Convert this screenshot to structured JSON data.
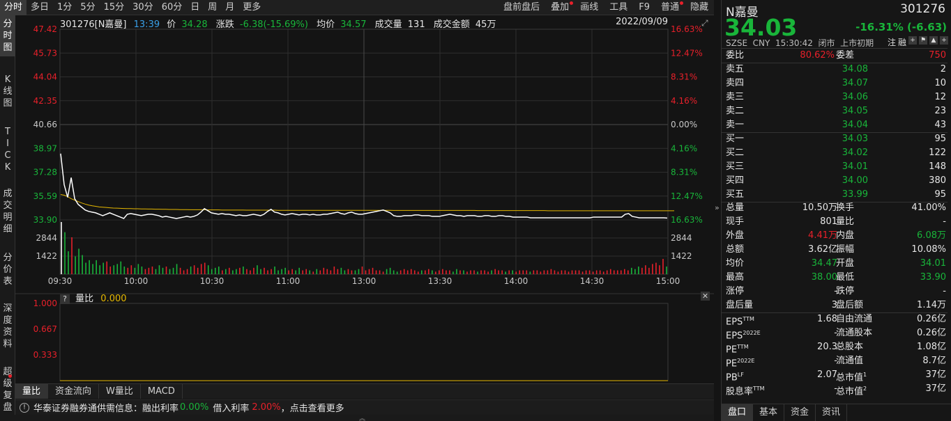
{
  "toolbar": {
    "items": [
      "分时",
      "多日",
      "1分",
      "5分",
      "15分",
      "30分",
      "60分",
      "日",
      "周",
      "月",
      "更多"
    ],
    "active_index": 0,
    "right_items": [
      "盘前盘后",
      "叠加",
      "画线",
      "工具",
      "F9",
      "普通",
      "隐藏"
    ]
  },
  "left_tabs": [
    "分时图",
    "K线图",
    "TICK",
    "成交明细",
    "分价表",
    "深度资料",
    "超级复盘"
  ],
  "chart_info": {
    "code": "301276[N嘉曼]",
    "time": "13:39",
    "price_label": "价",
    "price": "34.28",
    "change_label": "涨跌",
    "change": "-6.38(-15.69%)",
    "avg_label": "均价",
    "avg": "34.57",
    "vol_label": "成交量",
    "vol": "131",
    "amount_label": "成交金额",
    "amount": "45万",
    "date": "2022/09/09"
  },
  "chart_data": {
    "type": "line",
    "price_ticks": [
      "47.42",
      "45.73",
      "44.04",
      "42.35",
      "40.66",
      "38.97",
      "37.28",
      "35.59",
      "33.90"
    ],
    "pct_ticks": [
      "16.63%",
      "12.47%",
      "8.31%",
      "4.16%",
      "0.00%",
      "4.16%",
      "8.31%",
      "12.47%",
      "16.63%"
    ],
    "y_range": [
      33.9,
      47.42
    ],
    "prev_close": 40.66,
    "vol_ticks": [
      "2844",
      "1422"
    ],
    "vol_range": [
      0,
      4266
    ],
    "time_ticks": [
      "09:30",
      "10:00",
      "10:30",
      "11:00",
      "13:00",
      "13:30",
      "14:00",
      "14:30",
      "15:00"
    ],
    "price_series": [
      38.6,
      36.4,
      35.5,
      36.9,
      35.4,
      35.0,
      34.8,
      34.6,
      34.5,
      34.45,
      34.4,
      34.3,
      34.2,
      34.3,
      34.4,
      34.3,
      34.2,
      34.1,
      34.0,
      34.3,
      34.35,
      34.3,
      34.25,
      34.2,
      34.25,
      34.3,
      34.3,
      34.25,
      34.2,
      34.1,
      34.15,
      34.1,
      34.05,
      34.0,
      34.05,
      34.1,
      34.15,
      34.1,
      34.15,
      34.25,
      34.45,
      34.7,
      34.55,
      34.4,
      34.35,
      34.3,
      34.35,
      34.3,
      34.3,
      34.25,
      34.2,
      34.25,
      34.2,
      34.2,
      34.25,
      34.3,
      34.25,
      34.2,
      34.3,
      34.5,
      34.65,
      34.45,
      34.4,
      34.3,
      34.25,
      34.3,
      34.35,
      34.3,
      34.25,
      34.3,
      34.3,
      34.25,
      34.3,
      34.25,
      34.25,
      34.3,
      34.3,
      34.35,
      34.4,
      34.45,
      34.35,
      34.3,
      34.4,
      34.45,
      34.35,
      34.3,
      34.3,
      34.35,
      34.4,
      34.45,
      34.5,
      34.55,
      34.6,
      34.5,
      34.4,
      34.2,
      34.15,
      34.15,
      34.2,
      34.2,
      34.2,
      34.25,
      34.25,
      34.2,
      34.2,
      34.2,
      34.15,
      34.15,
      34.15,
      34.2,
      34.25,
      34.3,
      34.25,
      34.2,
      34.2,
      34.15,
      34.2,
      34.2,
      34.2,
      34.15,
      34.15,
      34.2,
      34.2,
      34.15,
      34.15,
      34.2,
      34.2,
      34.15,
      34.15,
      34.1,
      34.1,
      34.1,
      34.1,
      34.1,
      34.05,
      34.05,
      34.05,
      34.05,
      34.05,
      34.05,
      34.05,
      34.05,
      34.05,
      34.05,
      34.05,
      34.05,
      34.05,
      34.05,
      34.05,
      34.05,
      34.05,
      34.05,
      34.1,
      34.1,
      34.1,
      34.1,
      34.1,
      34.1,
      34.1,
      34.1,
      34.1,
      34.3,
      34.35,
      34.15,
      34.1,
      34.05,
      34.05,
      34.05,
      34.05,
      34.05,
      34.05,
      34.05,
      34.05,
      34.03
    ],
    "avg_series": [
      35.7,
      35.65,
      35.55,
      35.4,
      35.3,
      35.2,
      35.1,
      35.02,
      34.95,
      34.9,
      34.86,
      34.82,
      34.8,
      34.78,
      34.76,
      34.74,
      34.73,
      34.72,
      34.71,
      34.7,
      34.7,
      34.69,
      34.69,
      34.68,
      34.68,
      34.67,
      34.67,
      34.66,
      34.66,
      34.65,
      34.65,
      34.64,
      34.64,
      34.64,
      34.63,
      34.63,
      34.63,
      34.62,
      34.62,
      34.62,
      34.62,
      34.62,
      34.61,
      34.61,
      34.61,
      34.61,
      34.6,
      34.6,
      34.6,
      34.6,
      34.6,
      34.6,
      34.6,
      34.59,
      34.59,
      34.59,
      34.59,
      34.59,
      34.59,
      34.59,
      34.59,
      34.59,
      34.58,
      34.58,
      34.58,
      34.58,
      34.58,
      34.58,
      34.58,
      34.58,
      34.58,
      34.58,
      34.58,
      34.58,
      34.58,
      34.58,
      34.58,
      34.58,
      34.58,
      34.58,
      34.58,
      34.58,
      34.58,
      34.58,
      34.58,
      34.58,
      34.58,
      34.58,
      34.58,
      34.58,
      34.58,
      34.58,
      34.58,
      34.58,
      34.58,
      34.57,
      34.57,
      34.57,
      34.57,
      34.57,
      34.57,
      34.57,
      34.57,
      34.57,
      34.57,
      34.57,
      34.57,
      34.57,
      34.57,
      34.57,
      34.57,
      34.57,
      34.57,
      34.57,
      34.57,
      34.57,
      34.57,
      34.57,
      34.57,
      34.56,
      34.56,
      34.56,
      34.56,
      34.56,
      34.56,
      34.56,
      34.56,
      34.56,
      34.56,
      34.56,
      34.56,
      34.56,
      34.56,
      34.56,
      34.56,
      34.56,
      34.56,
      34.56,
      34.56,
      34.55,
      34.55,
      34.55,
      34.55,
      34.55,
      34.55,
      34.55,
      34.55,
      34.55,
      34.55,
      34.55,
      34.55,
      34.55,
      34.55,
      34.55,
      34.55,
      34.55,
      34.55,
      34.55,
      34.55,
      34.55,
      34.55,
      34.55,
      34.55,
      34.55,
      34.55,
      34.55,
      34.55,
      34.55,
      34.55,
      34.55,
      34.55,
      34.55,
      34.55,
      34.55,
      34.55,
      34.55
    ],
    "volume_series": [
      4100,
      3300,
      1800,
      2900,
      1400,
      2000,
      1500,
      900,
      1100,
      800,
      1100,
      700,
      900,
      1000,
      600,
      700,
      800,
      1000,
      600,
      500,
      700,
      500,
      800,
      600,
      400,
      500,
      600,
      400,
      700,
      500,
      600,
      400,
      500,
      800,
      500,
      300,
      400,
      600,
      700,
      500,
      800,
      900,
      700,
      400,
      500,
      600,
      300,
      400,
      500,
      300,
      400,
      500,
      600,
      400,
      300,
      500,
      700,
      400,
      500,
      300,
      400,
      600,
      300,
      400,
      500,
      300,
      400,
      300,
      500,
      300,
      400,
      300,
      200,
      400,
      300,
      500,
      400,
      300,
      600,
      400,
      500,
      300,
      400,
      300,
      300,
      400,
      600,
      300,
      400,
      500,
      300,
      300,
      200,
      400,
      500,
      300,
      200,
      300,
      400,
      300,
      400,
      300,
      200,
      300,
      300,
      400,
      300,
      200,
      300,
      400,
      300,
      300,
      200,
      400,
      300,
      300,
      200,
      300,
      300,
      200,
      300,
      300,
      200,
      300,
      400,
      300,
      300,
      200,
      300,
      300,
      200,
      300,
      300,
      300,
      200,
      300,
      300,
      200,
      300,
      300,
      400,
      300,
      200,
      300,
      300,
      200,
      300,
      300,
      300,
      200,
      300,
      300,
      200,
      300,
      300,
      200,
      300,
      400,
      300,
      300,
      300,
      400,
      300,
      500,
      400,
      600,
      500,
      700,
      500,
      800,
      900,
      700,
      1200,
      600
    ],
    "ratio_ticks": [
      "1.000",
      "0.667",
      "0.333"
    ]
  },
  "sub_chart": {
    "help": "?",
    "label": "量比",
    "value": "0.000"
  },
  "bottom_tabs": [
    "量比",
    "资金流向",
    "W量比",
    "MACD"
  ],
  "status": {
    "text1": "华泰证券融券通供需信息：融出利率",
    "rate1": "0.00%",
    "text2": "借入利率",
    "rate2": "2.00%",
    "text3": "，点击查看更多"
  },
  "right_panel": {
    "name": "N嘉曼",
    "code": "301276",
    "price": "34.03",
    "change": "-16.31% (-6.63)",
    "meta": "SZSE  CNY  15:30:42  闭市  上市初期",
    "meta_icons": [
      "注",
      "融",
      "+",
      "⚑",
      "▲",
      "+"
    ],
    "weibi": {
      "label": "委比",
      "value": "80.62%",
      "label2": "委差",
      "value2": "750"
    },
    "asks": [
      {
        "label": "卖五",
        "price": "34.08",
        "vol": "2"
      },
      {
        "label": "卖四",
        "price": "34.07",
        "vol": "10"
      },
      {
        "label": "卖三",
        "price": "34.06",
        "vol": "12"
      },
      {
        "label": "卖二",
        "price": "34.05",
        "vol": "23"
      },
      {
        "label": "卖一",
        "price": "34.04",
        "vol": "43"
      }
    ],
    "bids": [
      {
        "label": "买一",
        "price": "34.03",
        "vol": "95"
      },
      {
        "label": "买二",
        "price": "34.02",
        "vol": "122"
      },
      {
        "label": "买三",
        "price": "34.01",
        "vol": "148"
      },
      {
        "label": "买四",
        "price": "34.00",
        "vol": "380"
      },
      {
        "label": "买五",
        "price": "33.99",
        "vol": "95"
      }
    ],
    "stats": [
      {
        "l1": "总量",
        "v1": "10.50万",
        "c1": "white",
        "l2": "换手",
        "v2": "41.00%",
        "c2": "white"
      },
      {
        "l1": "现手",
        "v1": "801",
        "c1": "white",
        "l2": "量比",
        "v2": "-",
        "c2": "white"
      },
      {
        "l1": "外盘",
        "v1": "4.41万",
        "c1": "red",
        "l2": "内盘",
        "v2": "6.08万",
        "c2": "green"
      },
      {
        "l1": "总额",
        "v1": "3.62亿",
        "c1": "white",
        "l2": "振幅",
        "v2": "10.08%",
        "c2": "white"
      },
      {
        "l1": "均价",
        "v1": "34.47",
        "c1": "green",
        "l2": "开盘",
        "v2": "34.01",
        "c2": "green"
      },
      {
        "l1": "最高",
        "v1": "38.00",
        "c1": "green",
        "l2": "最低",
        "v2": "33.90",
        "c2": "green"
      },
      {
        "l1": "涨停",
        "v1": "-",
        "c1": "white",
        "l2": "跌停",
        "v2": "-",
        "c2": "white"
      },
      {
        "l1": "盘后量",
        "v1": "3",
        "c1": "white",
        "l2": "盘后额",
        "v2": "1.14万",
        "c2": "white"
      }
    ],
    "fund": [
      {
        "l1": "EPS",
        "s1": "TTM",
        "v1": "1.68",
        "l2": "自由流通",
        "s2": "",
        "v2": "0.26亿"
      },
      {
        "l1": "EPS",
        "s1": "2022E",
        "v1": "-",
        "l2": "流通股本",
        "s2": "",
        "v2": "0.26亿"
      },
      {
        "l1": "PE",
        "s1": "TTM",
        "v1": "20.3",
        "l2": "总股本",
        "s2": "",
        "v2": "1.08亿"
      },
      {
        "l1": "PE",
        "s1": "2022E",
        "v1": "-",
        "l2": "流通值",
        "s2": "",
        "v2": "8.7亿"
      },
      {
        "l1": "PB",
        "s1": "LF",
        "v1": "2.07",
        "l2": "总市值",
        "s2": "1",
        "v2": "37亿"
      },
      {
        "l1": "股息率",
        "s1": "TTM",
        "v1": "-",
        "l2": "总市值",
        "s2": "2",
        "v2": "37亿"
      }
    ],
    "tabs": [
      "盘口",
      "基本",
      "资金",
      "资讯"
    ]
  },
  "colors": {
    "up": "#e8202a",
    "down": "#19b53a",
    "price_line": "#ffffff",
    "avg_line": "#e6b800",
    "grid": "#2e2e2e"
  }
}
